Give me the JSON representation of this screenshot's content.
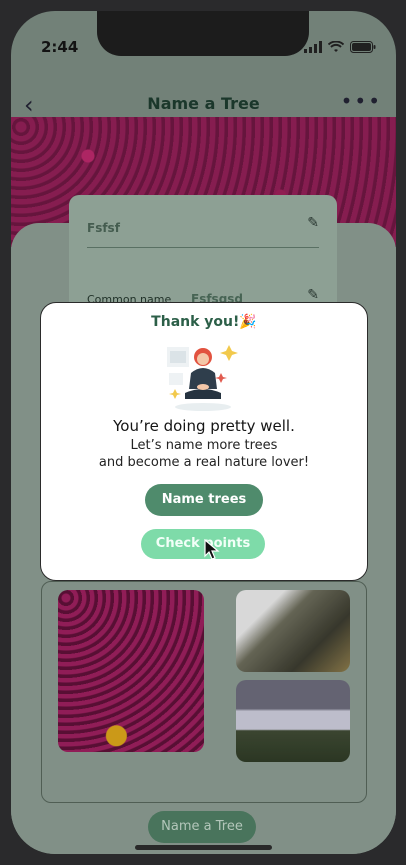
{
  "status_bar": {
    "time": "2:44"
  },
  "header": {
    "title": "Name a Tree"
  },
  "form": {
    "scientific_name": "Fsfsf",
    "common_name_label": "Common name",
    "common_name_value": "Fsfsgsd"
  },
  "modal": {
    "title": "Thank you!🎉",
    "message_main": "You’re doing pretty well.",
    "message_line1": "Let’s name more trees",
    "message_line2": "and become a real nature lover!",
    "primary_button": "Name trees",
    "secondary_button": "Check points"
  },
  "footer": {
    "name_tree_button": "Name a Tree"
  },
  "colors": {
    "accent_green": "#4f8b6c",
    "light_green": "#7edba9",
    "title_green": "#2c5f48"
  }
}
